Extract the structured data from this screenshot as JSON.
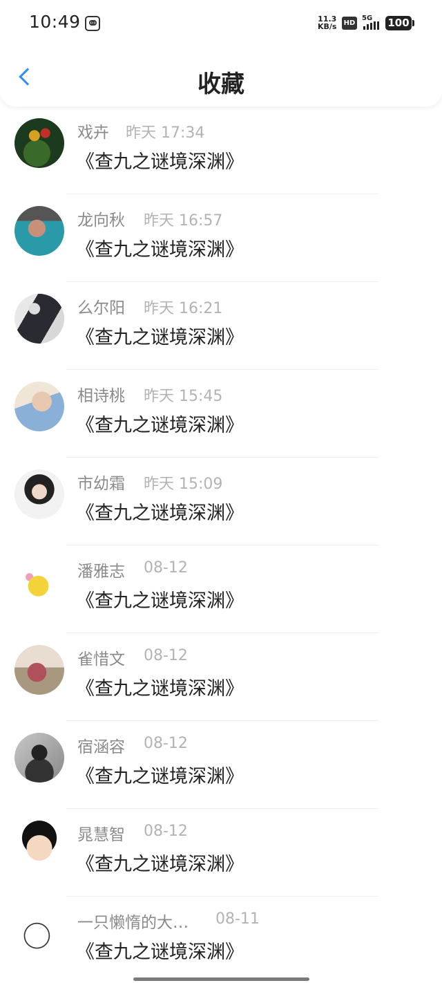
{
  "status_bar": {
    "time": "10:49",
    "net_speed_value": "11.3",
    "net_speed_unit": "KB/s",
    "hd_badge": "HD",
    "network": "5G",
    "battery": "100"
  },
  "header": {
    "title": "收藏",
    "back_icon": "chevron-left-icon"
  },
  "colors": {
    "accent": "#2a8ff0",
    "name_text": "#8a8a8a",
    "time_text": "#b3b3b3",
    "title_text": "#222222"
  },
  "favorites": [
    {
      "name": "戏卉",
      "time": "昨天 17:34",
      "title": "《查九之谜境深渊》"
    },
    {
      "name": "龙向秋",
      "time": "昨天 16:57",
      "title": "《查九之谜境深渊》"
    },
    {
      "name": "么尔阳",
      "time": "昨天 16:21",
      "title": "《查九之谜境深渊》"
    },
    {
      "name": "相诗桃",
      "time": "昨天 15:45",
      "title": "《查九之谜境深渊》"
    },
    {
      "name": "市幼霜",
      "time": "昨天 15:09",
      "title": "《查九之谜境深渊》"
    },
    {
      "name": "潘雅志",
      "time": "08-12",
      "title": "《查九之谜境深渊》"
    },
    {
      "name": "雀惜文",
      "time": "08-12",
      "title": "《查九之谜境深渊》"
    },
    {
      "name": "宿涵容",
      "time": "08-12",
      "title": "《查九之谜境深渊》"
    },
    {
      "name": "晁慧智",
      "time": "08-12",
      "title": "《查九之谜境深渊》"
    },
    {
      "name": "一只懒惰的大…",
      "time": "08-11",
      "title": "《查九之谜境深渊》"
    }
  ]
}
